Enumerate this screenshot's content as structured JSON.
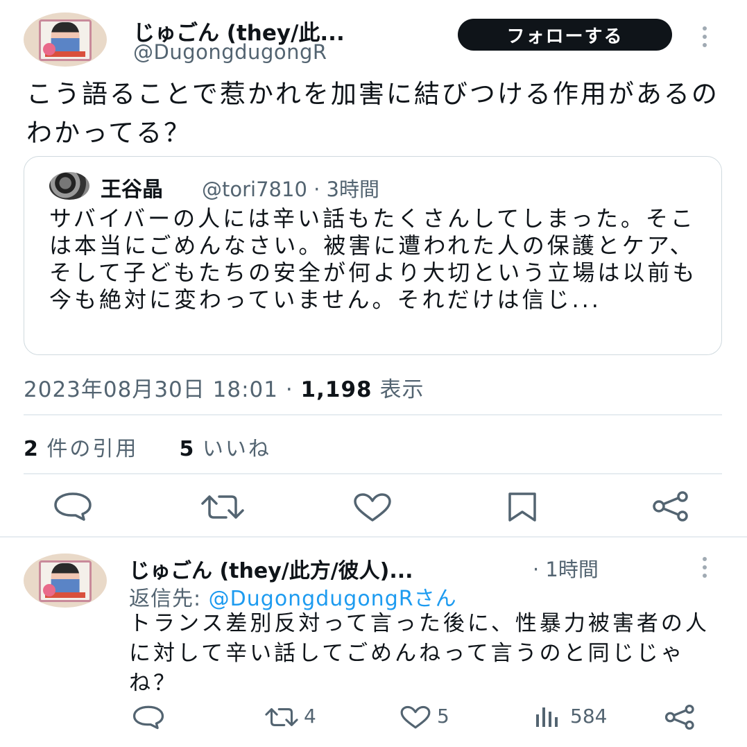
{
  "main_tweet": {
    "author_name": "じゅごん (they/此...",
    "author_handle": "@DugongdugongR",
    "follow_label": "フォローする",
    "text": "こう語ることで惹かれを加害に結びつける作用があるのわかってる？",
    "quote": {
      "author_name": "王谷晶",
      "author_meta": "@tori7810 · 3時間",
      "text": "サバイバーの人には辛い話もたくさんしてしまった。そこは本当にごめんなさい。被害に遭われた人の保護とケア、そして子どもたちの安全が何より大切という立場は以前も今も絶対に変わっていません。それだけは信じ..."
    },
    "timestamp": "2023年08月30日 18:01 · ",
    "views_count": "1,198",
    "views_label": " 表示",
    "quotes_count": "2",
    "quotes_label": " 件の引用",
    "likes_count": "5",
    "likes_label": " いいね",
    "actions": [
      "reply-icon",
      "retweet-icon",
      "like-icon",
      "bookmark-icon",
      "share-icon"
    ]
  },
  "reply_tweet": {
    "author_name": "じゅごん (they/此方/彼人)...",
    "time": " · 1時間",
    "reply_to_prefix": "返信先: ",
    "reply_to_handle": "@DugongdugongRさん",
    "text": "トランス差別反対って言った後に、性暴力被害者の人に対して辛い話してごめんねって言うのと同じじゃね？",
    "retweets": "4",
    "likes": "5",
    "views": "584"
  },
  "colors": {
    "text_primary": "#0f1419",
    "text_secondary": "#536471",
    "link": "#1d9bf0",
    "border": "#cfd9de"
  }
}
